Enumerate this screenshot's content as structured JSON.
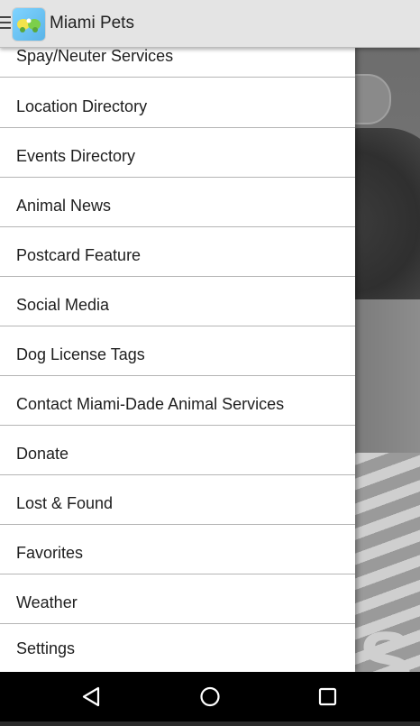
{
  "app": {
    "title": "Miami Pets"
  },
  "drawer": {
    "items": [
      {
        "label": "Spay/Neuter Services"
      },
      {
        "label": "Location Directory"
      },
      {
        "label": "Events Directory"
      },
      {
        "label": "Animal News"
      },
      {
        "label": "Postcard Feature"
      },
      {
        "label": "Social Media"
      },
      {
        "label": "Dog License Tags"
      },
      {
        "label": "Contact Miami-Dade Animal Services"
      },
      {
        "label": "Donate"
      },
      {
        "label": "Lost & Found"
      },
      {
        "label": "Favorites"
      },
      {
        "label": "Weather"
      },
      {
        "label": "Settings"
      }
    ]
  },
  "navbar": {
    "icons": [
      "back-icon",
      "home-icon",
      "recents-icon"
    ]
  }
}
